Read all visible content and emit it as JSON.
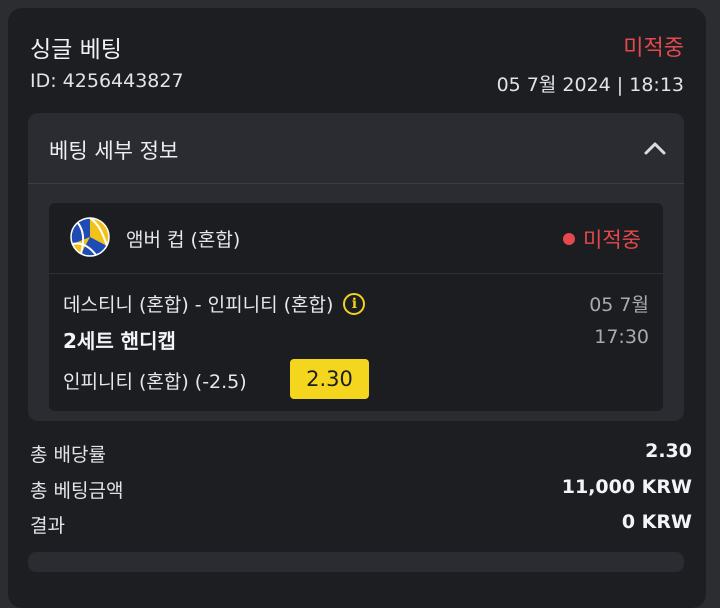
{
  "bet": {
    "title": "싱글 베팅",
    "status": "미적중",
    "id_text": "ID: 4256443827",
    "datetime": "05 7월 2024 | 18:13"
  },
  "details": {
    "title": "베팅 세부 정보",
    "chevron_icon": "chevron-up-icon"
  },
  "event": {
    "sport_icon": "volleyball-icon",
    "league": "앰버 컵 (혼합)",
    "status": "미적중",
    "match": "데스티니 (혼합) - 인피니티 (혼합)",
    "info_icon_glyph": "i",
    "date": "05 7월",
    "market": "2세트 핸디캡",
    "time": "17:30",
    "selection": "인피니티 (혼합) (-2.5)",
    "odds": "2.30"
  },
  "summary": {
    "total_odds_label": "총 배당률",
    "total_odds_value": "2.30",
    "total_stake_label": "총 베팅금액",
    "total_stake_value": "11,000 KRW",
    "result_label": "결과",
    "result_value": "0 KRW"
  },
  "colors": {
    "loss": "#e5484d",
    "odds_badge": "#f5d61f",
    "card_bg": "#1c1e22",
    "panel_bg": "#2a2c31"
  }
}
